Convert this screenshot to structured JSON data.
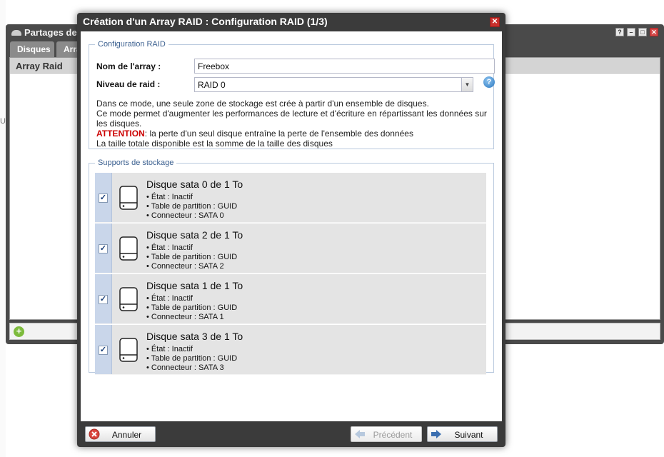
{
  "background_window": {
    "title": "Partages de",
    "tabs": [
      "Disques",
      "Arra"
    ],
    "panel_title": "Array Raid",
    "controls": [
      "?",
      "–",
      "□",
      "✕"
    ],
    "left_mark": "U"
  },
  "dialog": {
    "title": "Création d'un Array RAID : Configuration RAID (1/3)",
    "close_label": "✕",
    "config_section": {
      "legend": "Configuration RAID",
      "name_label": "Nom de l'array :",
      "name_value": "Freebox",
      "level_label": "Niveau de raid :",
      "level_value": "RAID 0",
      "help_label": "?",
      "description": [
        "Dans ce mode, une seule zone de stockage est crée à partir d'un ensemble de disques.",
        "Ce mode permet d'augmenter les performances de lecture et d'écriture en répartissant les données sur",
        "les disques."
      ],
      "attention_label": "ATTENTION",
      "attention_text": ": la perte d'un seul disque entraîne la perte de l'ensemble des données",
      "total_text": "La taille totale disponible est la somme de la taille des disques"
    },
    "storage_section": {
      "legend": "Supports de stockage",
      "disks": [
        {
          "name": "Disque sata 0 de 1 To",
          "state": "• État : Inactif",
          "table": "• Table de partition : GUID",
          "connector": "• Connecteur : SATA 0",
          "checked": true
        },
        {
          "name": "Disque sata 2 de 1 To",
          "state": "• État : Inactif",
          "table": "• Table de partition : GUID",
          "connector": "• Connecteur : SATA 2",
          "checked": true
        },
        {
          "name": "Disque sata 1 de 1 To",
          "state": "• État : Inactif",
          "table": "• Table de partition : GUID",
          "connector": "• Connecteur : SATA 1",
          "checked": true
        },
        {
          "name": "Disque sata 3 de 1 To",
          "state": "• État : Inactif",
          "table": "• Table de partition : GUID",
          "connector": "• Connecteur : SATA 3",
          "checked": true
        }
      ]
    },
    "footer": {
      "cancel": "Annuler",
      "previous": "Précédent",
      "next": "Suivant"
    }
  },
  "colors": {
    "dialog_frame": "#3b3b3b",
    "attention": "#cc0000",
    "disk_row": "#e4e4e4",
    "legend": "#3a5f8f"
  }
}
